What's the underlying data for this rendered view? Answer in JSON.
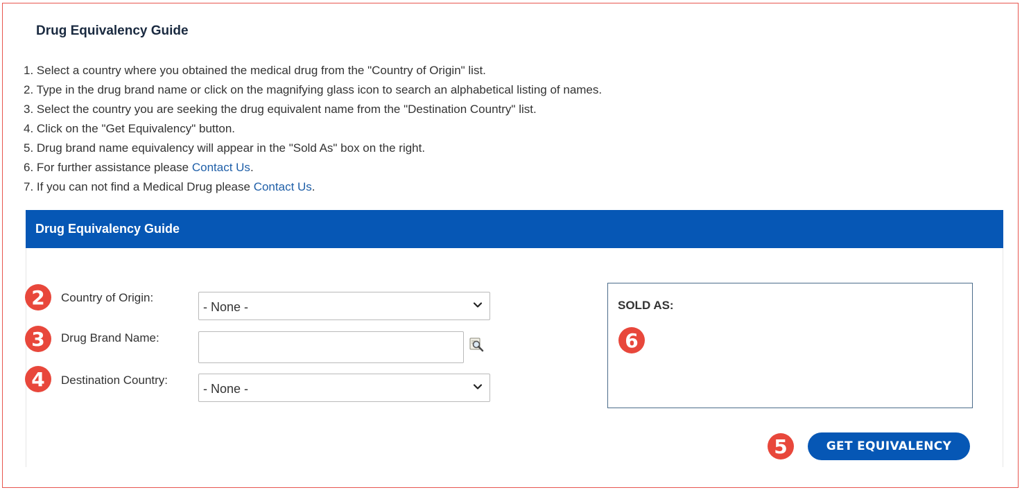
{
  "page": {
    "title": "Drug Equivalency Guide"
  },
  "instructions": [
    {
      "text": "1. Select a country where you obtained the medical drug from the \"Country of Origin\" list.",
      "link": ""
    },
    {
      "text": "2. Type in the drug brand name or click on the magnifying glass icon to search an alphabetical listing of names.",
      "link": ""
    },
    {
      "text": "3. Select the country you are seeking the drug equivalent name from the \"Destination Country\" list.",
      "link": ""
    },
    {
      "text": "4. Click on the \"Get Equivalency\" button.",
      "link": ""
    },
    {
      "text": "5. Drug brand name equivalency will appear in the \"Sold As\" box on the right.",
      "link": ""
    },
    {
      "text": "6. For further assistance please ",
      "link": "Contact Us",
      "after": "."
    },
    {
      "text": "7. If you can not find a Medical Drug please ",
      "link": "Contact Us",
      "after": "."
    }
  ],
  "panel": {
    "title": "Drug Equivalency Guide"
  },
  "form": {
    "origin": {
      "label": "Country of Origin:",
      "value": "- None -",
      "marker": "2"
    },
    "brand": {
      "label": "Drug Brand Name:",
      "value": "",
      "marker": "3",
      "icon": "magnifier-lookup-icon"
    },
    "destination": {
      "label": "Destination Country:",
      "value": "- None -",
      "marker": "4"
    }
  },
  "result": {
    "label": "SOLD AS:",
    "marker": "6"
  },
  "action": {
    "label": "GET EQUIVALENCY",
    "marker": "5"
  },
  "colors": {
    "header_blue": "#0657b5",
    "marker_red": "#e8473b",
    "link_blue": "#1f5fa8",
    "frame_border": "#e8554e"
  }
}
